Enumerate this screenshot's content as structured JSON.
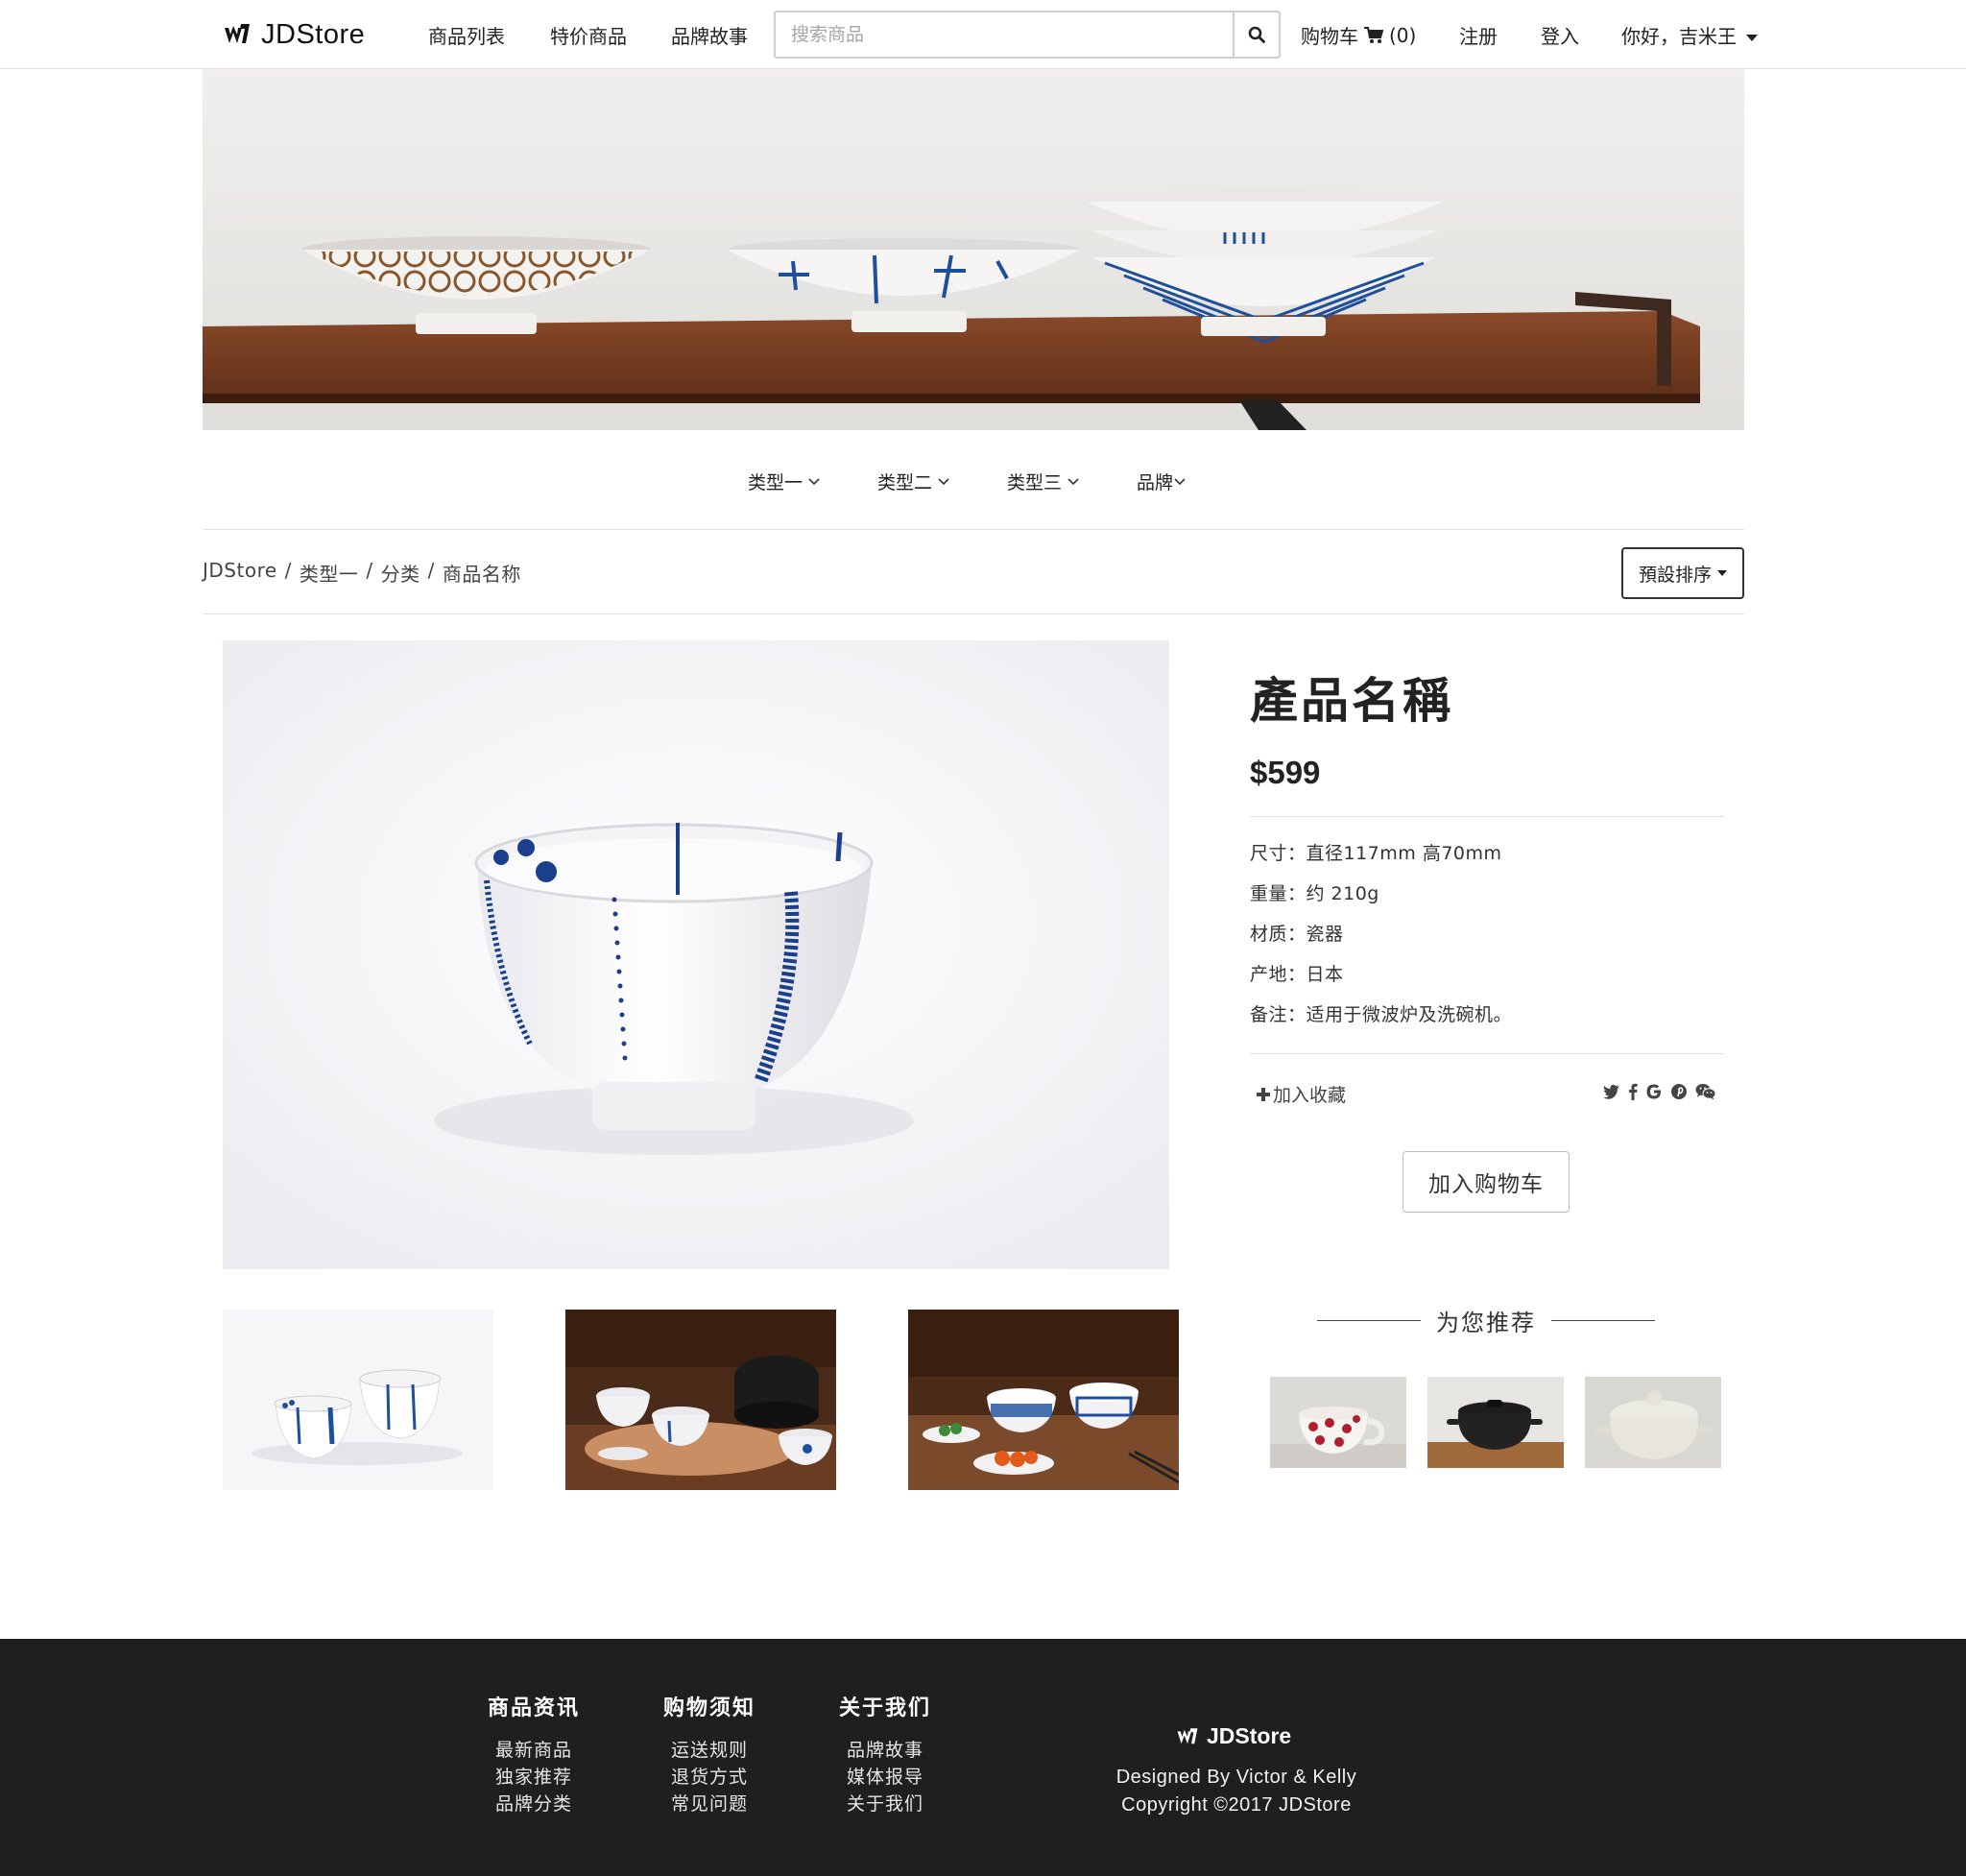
{
  "brand": {
    "name": "JDStore"
  },
  "nav": {
    "links": [
      "商品列表",
      "特价商品",
      "品牌故事"
    ],
    "search_placeholder": "搜索商品",
    "cart_label": "购物车",
    "cart_count": "(0)",
    "register": "注册",
    "login": "登入",
    "greeting": "你好，吉米王"
  },
  "categories": [
    "类型一",
    "类型二",
    "类型三",
    "品牌"
  ],
  "breadcrumb": [
    "JDStore",
    "类型一",
    "分类",
    "商品名称"
  ],
  "sort_label": "預設排序",
  "product": {
    "name": "產品名稱",
    "price": "$599",
    "specs": [
      "尺寸：直径117mm 高70mm",
      "重量：约 210g",
      "材质：瓷器",
      "产地：日本",
      "备注：适用于微波炉及洗碗机。"
    ],
    "favorite_label": "加入收藏",
    "add_to_cart": "加入购物车",
    "share_icons": [
      "twitter-icon",
      "facebook-icon",
      "google-icon",
      "pinterest-icon",
      "wechat-icon"
    ]
  },
  "recommend": {
    "title": "为您推荐"
  },
  "footer": {
    "columns": [
      {
        "title": "商品资讯",
        "links": [
          "最新商品",
          "独家推荐",
          "品牌分类"
        ]
      },
      {
        "title": "购物须知",
        "links": [
          "运送规则",
          "退货方式",
          "常见问题"
        ]
      },
      {
        "title": "关于我们",
        "links": [
          "品牌故事",
          "媒体报导",
          "关于我们"
        ]
      }
    ],
    "brand": "JDStore",
    "designed_by": "Designed By Victor & Kelly",
    "copyright": "Copyright ©2017 JDStore"
  },
  "colors": {
    "footer_bg": "#1f1f1f",
    "accent_blue": "#1e4f9c",
    "table_wood": "#7a3f22"
  }
}
